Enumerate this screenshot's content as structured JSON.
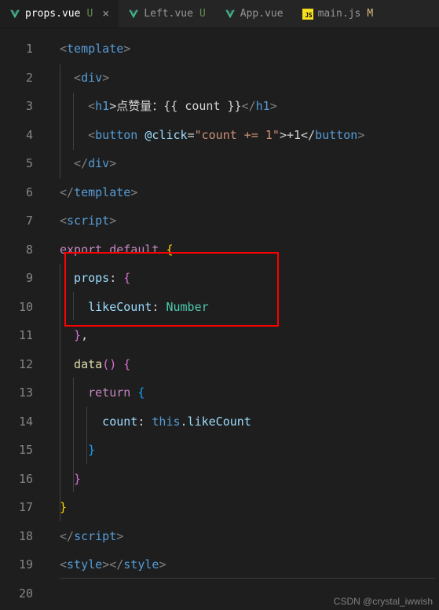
{
  "tabs": [
    {
      "icon": "vue",
      "name": "props.vue",
      "status": "U",
      "active": true,
      "closeable": true
    },
    {
      "icon": "vue",
      "name": "Left.vue",
      "status": "U",
      "active": false,
      "closeable": false
    },
    {
      "icon": "vue",
      "name": "App.vue",
      "status": "",
      "active": false,
      "closeable": false
    },
    {
      "icon": "js",
      "name": "main.js",
      "status": "M",
      "active": false,
      "closeable": false
    }
  ],
  "lines": {
    "count": 20
  },
  "code": {
    "l1": [
      "<",
      "template",
      ">"
    ],
    "l2": [
      "  <",
      "div",
      ">"
    ],
    "l3_a": "    <",
    "l3_b": "h1",
    "l3_c": ">点赞量：",
    "l3_d": "{{ count }}",
    "l3_e": "</",
    "l3_f": "h1",
    "l3_g": ">",
    "l4_a": "    <",
    "l4_b": "button",
    "l4_c": " @click",
    "l4_d": "=",
    "l4_e": "\"count += 1\"",
    "l4_f": ">+1</",
    "l4_g": "button",
    "l4_h": ">",
    "l5": [
      "  </",
      "div",
      ">"
    ],
    "l6": [
      "</",
      "template",
      ">"
    ],
    "l7": [
      "<",
      "script",
      ">"
    ],
    "l8_a": "export",
    "l8_b": " default",
    "l8_c": " {",
    "l9_a": "  props",
    "l9_b": ": ",
    "l9_c": "{",
    "l10_a": "    likeCount",
    "l10_b": ": ",
    "l10_c": "Number",
    "l11_a": "  }",
    "l11_b": ",",
    "l12_a": "  data",
    "l12_b": "() ",
    "l12_c": "{",
    "l13_a": "    return",
    "l13_b": " {",
    "l14_a": "      count",
    "l14_b": ": ",
    "l14_c": "this",
    "l14_d": ".likeCount",
    "l15": "    }",
    "l16": "  }",
    "l17": "}",
    "l18": [
      "</",
      "script",
      ">"
    ],
    "l19_a": "<",
    "l19_b": "style",
    "l19_c": "></",
    "l19_d": "style",
    "l19_e": ">"
  },
  "watermark": "CSDN @crystal_iwwish"
}
